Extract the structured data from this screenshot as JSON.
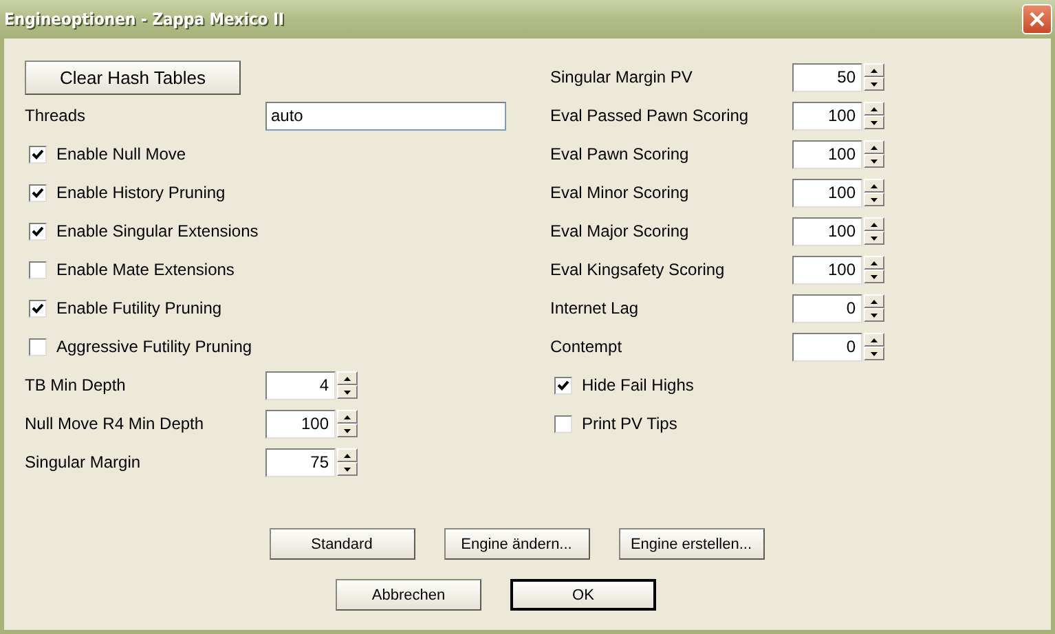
{
  "window": {
    "title": "Engineoptionen - Zappa Mexico II"
  },
  "left": [
    {
      "kind": "button",
      "label": "Clear Hash Tables"
    },
    {
      "kind": "text",
      "label": "Threads",
      "value": "auto"
    },
    {
      "kind": "checkbox",
      "label": "Enable Null Move",
      "checked": true
    },
    {
      "kind": "checkbox",
      "label": "Enable History Pruning",
      "checked": true
    },
    {
      "kind": "checkbox",
      "label": "Enable Singular Extensions",
      "checked": true
    },
    {
      "kind": "checkbox",
      "label": "Enable Mate Extensions",
      "checked": false
    },
    {
      "kind": "checkbox",
      "label": "Enable Futility Pruning",
      "checked": true
    },
    {
      "kind": "checkbox",
      "label": "Aggressive Futility Pruning",
      "checked": false
    },
    {
      "kind": "spin",
      "label": "TB Min Depth",
      "value": "4"
    },
    {
      "kind": "spin",
      "label": "Null Move R4 Min Depth",
      "value": "100"
    },
    {
      "kind": "spin",
      "label": "Singular Margin",
      "value": "75"
    }
  ],
  "right": [
    {
      "kind": "spin",
      "label": "Singular Margin PV",
      "value": "50"
    },
    {
      "kind": "spin",
      "label": "Eval Passed Pawn Scoring",
      "value": "100"
    },
    {
      "kind": "spin",
      "label": "Eval Pawn Scoring",
      "value": "100"
    },
    {
      "kind": "spin",
      "label": "Eval Minor Scoring",
      "value": "100"
    },
    {
      "kind": "spin",
      "label": "Eval Major Scoring",
      "value": "100"
    },
    {
      "kind": "spin",
      "label": "Eval Kingsafety Scoring",
      "value": "100"
    },
    {
      "kind": "spin",
      "label": "Internet Lag",
      "value": "0"
    },
    {
      "kind": "spin",
      "label": "Contempt",
      "value": "0"
    },
    {
      "kind": "checkbox",
      "label": "Hide Fail Highs",
      "checked": true
    },
    {
      "kind": "checkbox",
      "label": "Print PV Tips",
      "checked": false
    }
  ],
  "button_rows": [
    [
      {
        "label": "Standard",
        "default": false
      },
      {
        "label": "Engine ändern...",
        "default": false
      },
      {
        "label": "Engine erstellen...",
        "default": false
      }
    ],
    [
      {
        "label": "Abbrechen",
        "default": false
      },
      {
        "label": "OK",
        "default": true
      }
    ]
  ]
}
